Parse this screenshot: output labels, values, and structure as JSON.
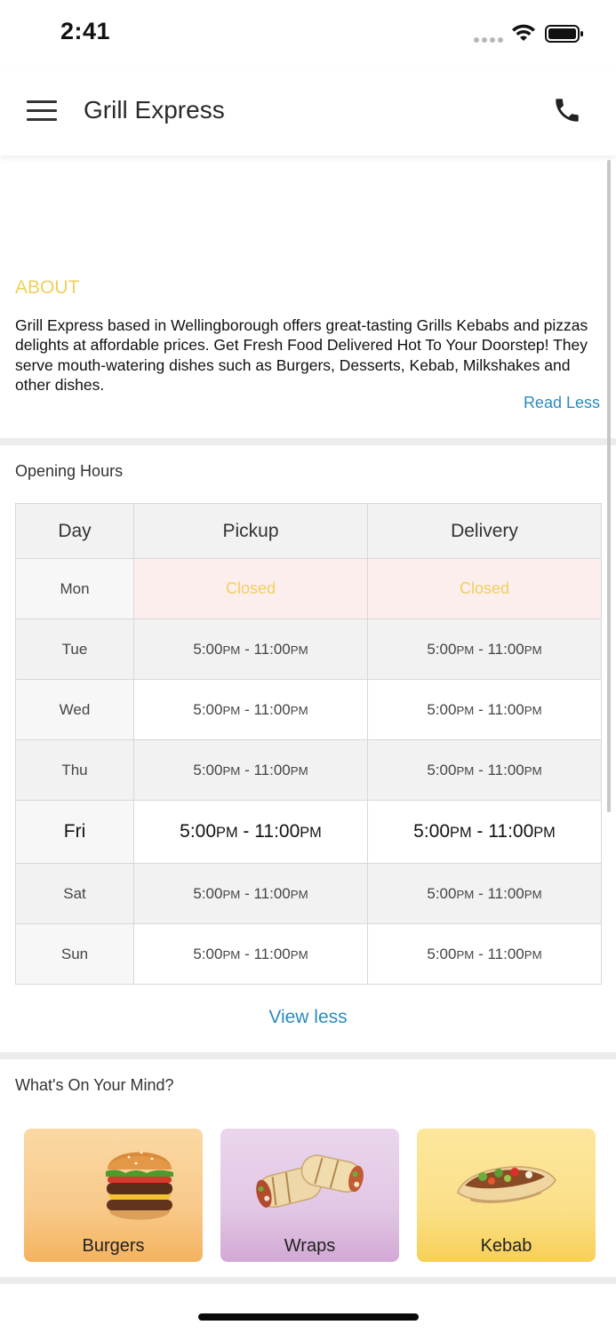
{
  "status_bar": {
    "time": "2:41"
  },
  "header": {
    "title": "Grill Express"
  },
  "about": {
    "heading": "ABOUT",
    "text": "Grill Express based in Wellingborough offers great-tasting Grills Kebabs and pizzas delights at affordable prices. Get Fresh Food Delivered Hot To Your Doorstep! They serve mouth-watering dishes such as Burgers, Desserts, Kebab, Milkshakes and other dishes.",
    "read_less": "Read Less"
  },
  "opening_hours": {
    "title": "Opening Hours",
    "columns": [
      "Day",
      "Pickup",
      "Delivery"
    ],
    "rows": [
      {
        "day": "Mon",
        "pickup": "Closed",
        "delivery": "Closed",
        "closed": true
      },
      {
        "day": "Tue",
        "open": "5:00",
        "open_ampm": "PM",
        "close": "11:00",
        "close_ampm": "PM"
      },
      {
        "day": "Wed",
        "open": "5:00",
        "open_ampm": "PM",
        "close": "11:00",
        "close_ampm": "PM"
      },
      {
        "day": "Thu",
        "open": "5:00",
        "open_ampm": "PM",
        "close": "11:00",
        "close_ampm": "PM"
      },
      {
        "day": "Fri",
        "open": "5:00",
        "open_ampm": "PM",
        "close": "11:00",
        "close_ampm": "PM",
        "today": true
      },
      {
        "day": "Sat",
        "open": "5:00",
        "open_ampm": "PM",
        "close": "11:00",
        "close_ampm": "PM"
      },
      {
        "day": "Sun",
        "open": "5:00",
        "open_ampm": "PM",
        "close": "11:00",
        "close_ampm": "PM"
      }
    ],
    "view_less": "View less"
  },
  "categories": {
    "title": "What's On Your Mind?",
    "items": [
      {
        "label": "Burgers",
        "icon": "burger-image"
      },
      {
        "label": "Wraps",
        "icon": "wrap-image"
      },
      {
        "label": "Kebab",
        "icon": "kebab-image"
      }
    ]
  },
  "colors": {
    "accent_yellow": "#f0cf5a",
    "link_blue": "#2a8bbd",
    "closed_bg": "#fdeeee"
  }
}
